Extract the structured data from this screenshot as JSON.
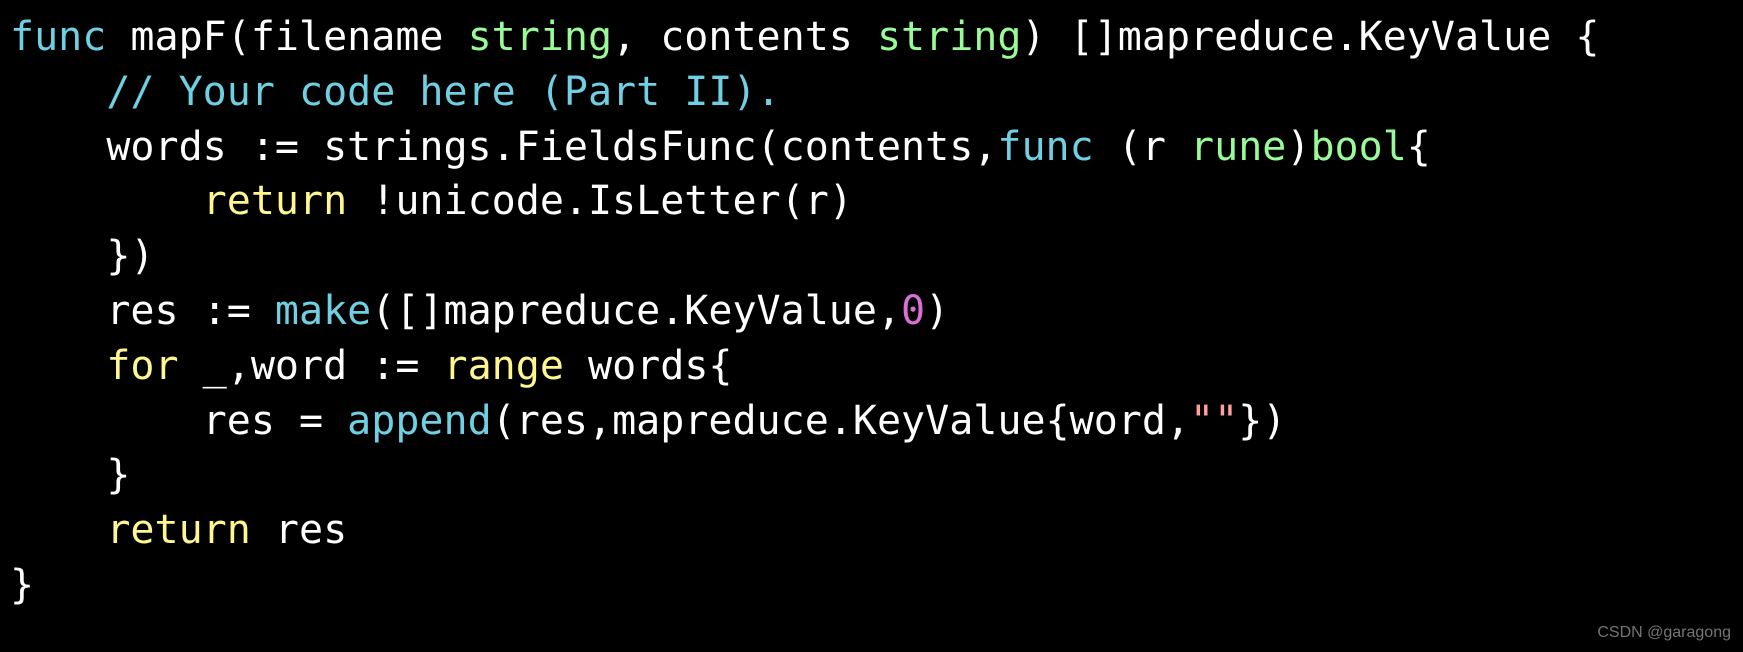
{
  "code": {
    "line1": {
      "func_kw": "func",
      "fn_name": " mapF(filename ",
      "type1": "string",
      "mid1": ", contents ",
      "type2": "string",
      "tail": ") []mapreduce.KeyValue {"
    },
    "line2": {
      "comment": "// Your code here (Part II)."
    },
    "line3": {
      "lead": "words := strings.FieldsFunc(contents,",
      "func_kw": "func",
      "mid": " (r ",
      "type_rune": "rune",
      "paren": ")",
      "type_bool": "bool",
      "brace": "{"
    },
    "line4": {
      "return_kw": "return",
      "rest": " !unicode.IsLetter(r)"
    },
    "line5": {
      "text": "})"
    },
    "line6": {
      "lead": "res := ",
      "make_kw": "make",
      "mid": "([]mapreduce.KeyValue,",
      "zero": "0",
      "tail": ")"
    },
    "line7": {
      "for_kw": "for",
      "mid": " _,word := ",
      "range_kw": "range",
      "tail": " words{"
    },
    "line8": {
      "lead": "res = ",
      "append_kw": "append",
      "mid": "(res,mapreduce.KeyValue{word,",
      "str": "\"\"",
      "tail": "})"
    },
    "line9": {
      "text": "}"
    },
    "line10": {
      "return_kw": "return",
      "rest": " res"
    },
    "line11": {
      "text": "}"
    }
  },
  "watermark": "CSDN @garagong"
}
